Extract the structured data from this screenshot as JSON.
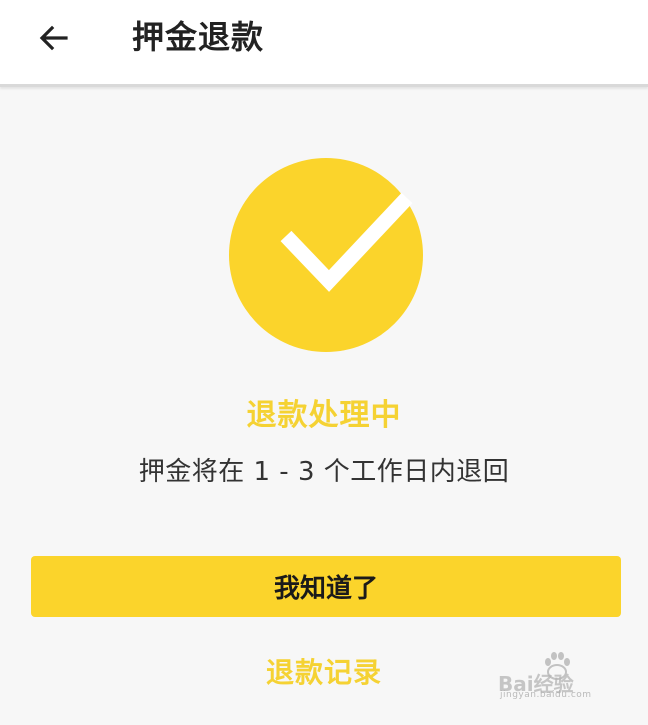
{
  "header": {
    "back_icon": "arrow-left-icon",
    "title": "押金退款"
  },
  "status": {
    "icon": "check-circle-icon",
    "icon_color": "#fbd42b",
    "title": "退款处理中",
    "description": "押金将在 1 - 3 个工作日内退回"
  },
  "actions": {
    "confirm_label": "我知道了",
    "records_link": "退款记录"
  },
  "colors": {
    "accent": "#fbd42b",
    "status_text": "#f5d233",
    "background": "#f7f7f7"
  },
  "watermark": {
    "text": "Bai经验",
    "subtext": "jingyan.baidu.com"
  }
}
